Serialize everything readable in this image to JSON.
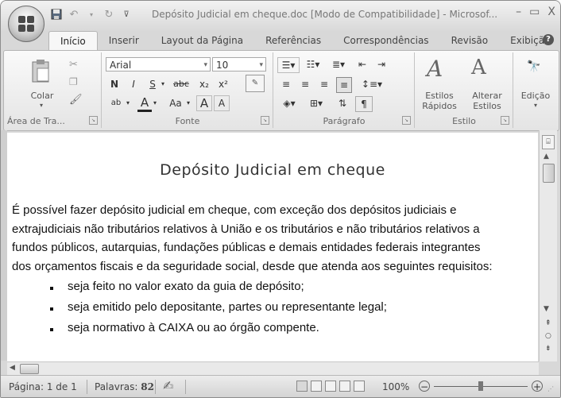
{
  "window": {
    "title": "Depósito Judicial em cheque.doc [Modo de Compatibilidade] - Microsof...",
    "controls": {
      "minimize": "–",
      "restore": "▭",
      "close": "X"
    }
  },
  "tabs": [
    {
      "label": "Início",
      "active": true
    },
    {
      "label": "Inserir"
    },
    {
      "label": "Layout da Página"
    },
    {
      "label": "Referências"
    },
    {
      "label": "Correspondências"
    },
    {
      "label": "Revisão"
    },
    {
      "label": "Exibição"
    }
  ],
  "ribbon": {
    "clipboard": {
      "paste_label": "Colar",
      "group_label": "Área de Tra..."
    },
    "font": {
      "name": "Arial",
      "size": "10",
      "bold": "N",
      "italic": "I",
      "underline": "S",
      "strike": "abc",
      "subscript": "x₂",
      "superscript": "x²",
      "grow": "A",
      "shrink": "A",
      "change_case": "Aa",
      "color": "A",
      "group_label": "Fonte"
    },
    "paragraph": {
      "group_label": "Parágrafo",
      "pilcrow": "¶"
    },
    "styles": {
      "quick_styles": "Estilos Rápidos",
      "change_styles": "Alterar Estilos",
      "group_label": "Estilo"
    },
    "editing": {
      "label": "Edição"
    }
  },
  "document": {
    "title": "Depósito Judicial em cheque",
    "paragraph_lines": [
      "É possível fazer depósito judicial em cheque, com exceção dos depósitos judiciais e",
      "extrajudiciais não tributários relativos à União e os tributários e não tributários relativos a",
      "fundos públicos, autarquias, fundações públicas e demais entidades federais integrantes",
      "dos orçamentos fiscais e da seguridade social, desde que atenda aos seguintes requisitos:"
    ],
    "bullets": [
      "seja feito no valor exato da guia de depósito;",
      "seja emitido pelo depositante, partes ou representante legal;",
      "seja normativo à CAIXA ou ao órgão compente."
    ]
  },
  "status": {
    "page": "Página: 1 de 1",
    "words_label": "Palavras:",
    "words_count": "82",
    "zoom": "100%",
    "zoom_level": 0.5
  }
}
